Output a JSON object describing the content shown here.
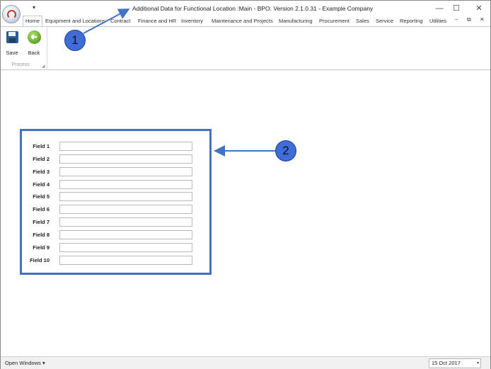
{
  "window": {
    "title": "Additional Data for Functional Location :Main - BPO: Version 2.1.0.31 - Example Company",
    "qat_arrow": "▾",
    "minimize": "—",
    "maximize": "☐",
    "close": "✕"
  },
  "tabs": [
    {
      "label": "Home"
    },
    {
      "label": "Equipment and Locations"
    },
    {
      "label": "Contract"
    },
    {
      "label": "Finance and HR"
    },
    {
      "label": "Inventory"
    },
    {
      "label": "Maintenance and Projects"
    },
    {
      "label": "Manufacturing"
    },
    {
      "label": "Procurement"
    },
    {
      "label": "Sales"
    },
    {
      "label": "Service"
    },
    {
      "label": "Reporting"
    },
    {
      "label": "Utilities"
    }
  ],
  "tab_controls": {
    "minimize": "–",
    "restore": "⧉",
    "close": "✕"
  },
  "ribbon": {
    "save_label": "Save",
    "back_label": "Back",
    "back_glyph": "➜",
    "group_label": "Process",
    "group_launcher": "◢"
  },
  "form": {
    "fields": [
      {
        "label": "Field 1",
        "value": ""
      },
      {
        "label": "Field 2",
        "value": ""
      },
      {
        "label": "Field 3",
        "value": ""
      },
      {
        "label": "Field 4",
        "value": ""
      },
      {
        "label": "Field 5",
        "value": ""
      },
      {
        "label": "Field 6",
        "value": ""
      },
      {
        "label": "Field 7",
        "value": ""
      },
      {
        "label": "Field 8",
        "value": ""
      },
      {
        "label": "Field 9",
        "value": ""
      },
      {
        "label": "Field 10",
        "value": ""
      }
    ]
  },
  "annotations": {
    "badge1": "1",
    "badge2": "2",
    "color": "#4472c4"
  },
  "statusbar": {
    "open_windows": "Open Windows ▾",
    "date": "15 Oct 2017",
    "date_dropdown": "▾"
  }
}
